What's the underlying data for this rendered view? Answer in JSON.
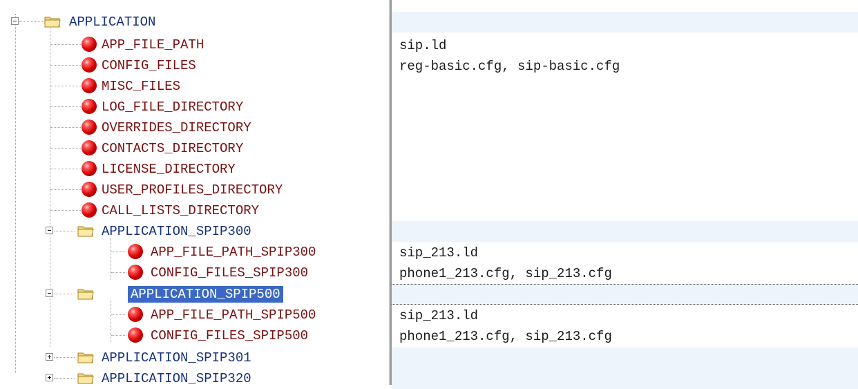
{
  "tree": {
    "root": {
      "label": "APPLICATION",
      "expanded": true,
      "value": ""
    },
    "root_params": [
      {
        "label": "APP_FILE_PATH",
        "value": "sip.ld"
      },
      {
        "label": "CONFIG_FILES",
        "value": "reg-basic.cfg, sip-basic.cfg"
      },
      {
        "label": "MISC_FILES",
        "value": ""
      },
      {
        "label": "LOG_FILE_DIRECTORY",
        "value": ""
      },
      {
        "label": "OVERRIDES_DIRECTORY",
        "value": ""
      },
      {
        "label": "CONTACTS_DIRECTORY",
        "value": ""
      },
      {
        "label": "LICENSE_DIRECTORY",
        "value": ""
      },
      {
        "label": "USER_PROFILES_DIRECTORY",
        "value": ""
      },
      {
        "label": "CALL_LISTS_DIRECTORY",
        "value": ""
      }
    ],
    "spip300": {
      "label": "APPLICATION_SPIP300",
      "expanded": true,
      "params": [
        {
          "label": "APP_FILE_PATH_SPIP300",
          "value": "sip_213.ld"
        },
        {
          "label": "CONFIG_FILES_SPIP300",
          "value": "phone1_213.cfg, sip_213.cfg"
        }
      ]
    },
    "spip500": {
      "label": "APPLICATION_SPIP500",
      "expanded": true,
      "selected": true,
      "params": [
        {
          "label": "APP_FILE_PATH_SPIP500",
          "value": "sip_213.ld"
        },
        {
          "label": "CONFIG_FILES_SPIP500",
          "value": "phone1_213.cfg, sip_213.cfg"
        }
      ]
    },
    "collapsed_folders": [
      {
        "label": "APPLICATION_SPIP301",
        "expanded": false
      },
      {
        "label": "APPLICATION_SPIP320",
        "expanded": false
      }
    ]
  },
  "icons": {
    "folder": "folder-icon",
    "param": "red-ball-icon"
  },
  "colors": {
    "selection": "#3a68c4",
    "param_text": "#7a1010",
    "folder_text": "#16327a"
  }
}
